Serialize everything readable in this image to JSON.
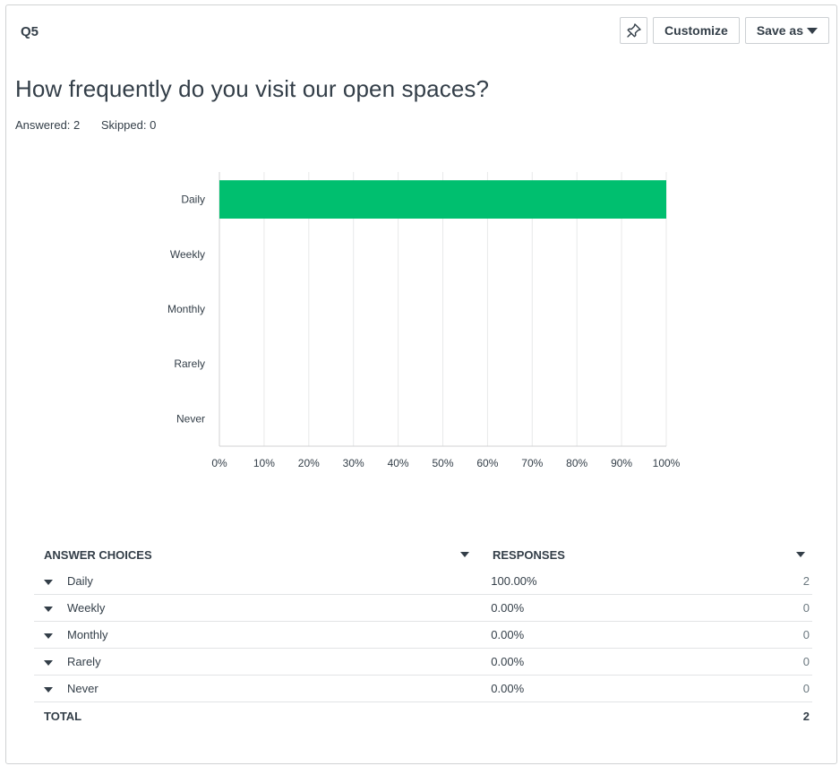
{
  "header": {
    "question_number": "Q5",
    "customize_label": "Customize",
    "save_as_label": "Save as"
  },
  "question": {
    "title": "How frequently do you visit our open spaces?",
    "answered": "Answered: 2",
    "skipped": "Skipped: 0"
  },
  "colors": {
    "bar": "#00bf6f",
    "grid": "#e8e9ea",
    "axis": "#d0d2d3",
    "text": "#333e48"
  },
  "chart_data": {
    "type": "bar",
    "orientation": "horizontal",
    "categories": [
      "Daily",
      "Weekly",
      "Monthly",
      "Rarely",
      "Never"
    ],
    "values": [
      100,
      0,
      0,
      0,
      0
    ],
    "xlim": [
      0,
      100
    ],
    "xticks": [
      "0%",
      "10%",
      "20%",
      "30%",
      "40%",
      "50%",
      "60%",
      "70%",
      "80%",
      "90%",
      "100%"
    ],
    "grid": true
  },
  "table": {
    "col_answer": "ANSWER CHOICES",
    "col_responses": "RESPONSES",
    "rows": [
      {
        "choice": "Daily",
        "percent": "100.00%",
        "count": "2"
      },
      {
        "choice": "Weekly",
        "percent": "0.00%",
        "count": "0"
      },
      {
        "choice": "Monthly",
        "percent": "0.00%",
        "count": "0"
      },
      {
        "choice": "Rarely",
        "percent": "0.00%",
        "count": "0"
      },
      {
        "choice": "Never",
        "percent": "0.00%",
        "count": "0"
      }
    ],
    "total_label": "TOTAL",
    "total_value": "2"
  }
}
